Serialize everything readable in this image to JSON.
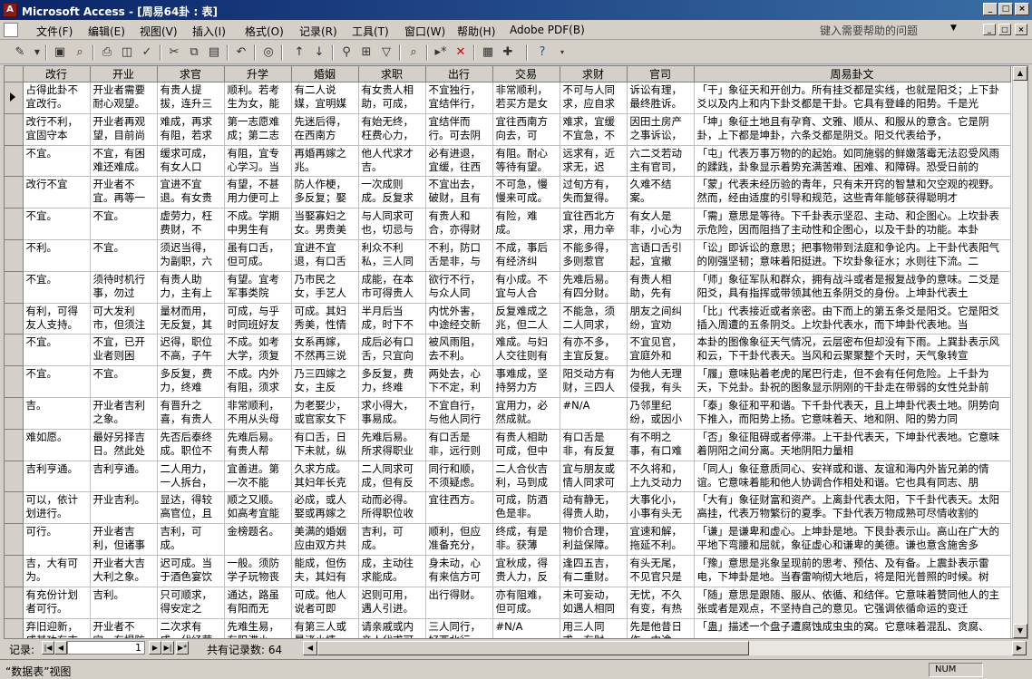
{
  "window": {
    "title": "Microsoft Access - [周易64卦 : 表]"
  },
  "menu": {
    "items": [
      "文件(F)",
      "编辑(E)",
      "视图(V)",
      "插入(I)",
      "格式(O)",
      "记录(R)",
      "工具(T)",
      "窗口(W)",
      "帮助(H)",
      "Adobe PDF(B)"
    ],
    "help_placeholder": "键入需要帮助的问题"
  },
  "table": {
    "columns": [
      "改行",
      "开业",
      "求官",
      "升学",
      "婚姻",
      "求职",
      "出行",
      "交易",
      "求财",
      "官司",
      "周易卦文"
    ],
    "rows": [
      [
        "占得此卦不宜改行。",
        "开业者需要耐心观望。",
        "有贵人提拔，连升三",
        "顺利。若考生为女，能",
        "有二人说媒，宜明媒",
        "有女贵人相助，可成，",
        "不宜独行，宜结伴行，",
        "非常顺利，若买方是女",
        "不可与人同求，应自求",
        "诉讼有理，最终胜诉。",
        "「干」象征天和开创力。所有挂爻都是实线，也就是阳爻；上下卦爻以及内上和内下卦爻都是干卦。它具有登峰的阳势。千是光"
      ],
      [
        "改行不利，宜固守本",
        "开业者再观望，目前尚",
        "难成，再求有阻，若求",
        "第一志愿难成；第二志",
        "先迷后得，在西南方",
        "有始无终，枉费心力，",
        "宜结伴而行。可去阴",
        "宜往西南方向去，可",
        "难求，宜缓不宜急，不",
        "因田土房产之事诉讼，",
        "「坤」象征土地且有孕育、文雅、顺从、和服从的意含。它是阴卦，上下都是坤卦，六条爻都是阴爻。阳爻代表给予，"
      ],
      [
        "不宜。",
        "不宜，有困难还难成。",
        "缓求可成，有女人口",
        "有阻，宜专心学习。当",
        "再婚再嫁之兆。",
        "他人代求才吉。",
        "必有进退，宜缓，往西",
        "有阻。耐心等待有望。",
        "远求有，近求无，迟",
        "六二爻若动主有官司，",
        "「屯」代表万事万物的的起始。如同施弱的鲜嫩落霉无法忍受风雨的蹂践，卦象显示着势充满苦难、困难、和障碍。恐受日前的"
      ],
      [
        "改行不宜",
        "开业者不宜。再等一",
        "宜进不宜退。有女贵",
        "有望，不甚用力便可上",
        "防人作梗，多反复；娶",
        "一次成则成。反复求",
        "不宜出去，破财，且有",
        "不可急，慢慢来可成。",
        "过旬方有，失而复得。",
        "久难不结案。",
        "「蒙」代表未经历验的青年，只有未开窍的智慧和欠空观的视野。然而，经由适度的引导和规范，这些青年能够获得聪明才"
      ],
      [
        "不宜。",
        "不宜。",
        "虚劳力，枉费财，不",
        "不成。学期中男生有",
        "当娶寡妇之女。男贵美",
        "与人同求可也，切忌与",
        "有贵人和合，亦得财",
        "有险，难成。",
        "宜往西北方求，用力辛",
        "有女人是非，小心为",
        "「需」意思是等待。下千卦表示坚忍、主动、和企图心。上坎卦表示危险，因而阻挡了主动性和企图心，以及干卦的功能。本卦"
      ],
      [
        "不利。",
        "不宜。",
        "须迟当得，为副职，六",
        "虽有口舌，但可成。",
        "宜进不宜退，有口舌",
        "利众不利私，三人同",
        "不利，防口舌是非，与",
        "不成，事后有经济纠",
        "不能多得，多则惹官",
        "言语口舌引起，宜撤",
        "「讼」即诉讼的意思；把事物带到法庭和争论内。上干卦代表阳气的刚强坚韧；意味着阳挺进。下坎卦象征水；水则往下流。二"
      ],
      [
        "不宜。",
        "须待时机行事，勿过",
        "有贵人助力，主有上",
        "有望。宜考军事类院",
        "乃市民之女，手艺人",
        "成能，在本市可得贵人",
        "欲行不行，与众人同",
        "有小成。不宜与人合",
        "先难后易。有四分财。",
        "有贵人相助，先有",
        "「师」象征军队和群众，拥有战斗或者是报复战争的意味。二爻是阳爻，具有指挥或带领其他五条阴爻的身份。上坤卦代表土"
      ],
      [
        "有利，可得友人支持。",
        "可大发利市，但须注",
        "量材而用，无反复，其",
        "可成，与乎时同班好友",
        "可成。其妇秀美，性情",
        "半月后当成，时下不",
        "内忧外害，中途经交新",
        "反复难成之兆，但二人",
        "不能急，须二人同求，不",
        "朋友之间纠纷，宜劝",
        "「比」代表接近或者亲密。由下而上的第五条爻是阳爻。它是阳爻插入周遭的五条阴爻。上坎卦代表水，而下坤卦代表地。当"
      ],
      [
        "不宜。",
        "不宜，已开业者则困",
        "迟得，职位不高，子午",
        "不成。如考大学，须复",
        "女系再嫁，不然再三说",
        "成后必有口舌，只宜向",
        "被风雨阻，去不利。",
        "难成。与妇人交往则有",
        "有亦不多，主宜反复。",
        "不宜见官，宜庭外和",
        "本卦的图像象征天气情况，云层密布但却没有下雨。上巽卦表示风和云，下干卦代表天。当风和云聚聚整个天时，天气象转宣"
      ],
      [
        "不宜。",
        "不宜。",
        "多反复，费力，终难",
        "不成。内外有阻，须求",
        "乃三四嫁之女，主反",
        "多反复，费力，终难",
        "两处去，心下不定，利",
        "事难成，坚持努力方",
        "阳爻动方有财，三四人",
        "为他人无理侵我，有头",
        "「履」意味贴着老虎的尾巴行走，但不会有任何危险。上千卦为天，下兑卦。卦祝的图象显示阴刚的干卦走在带弱的女性兑卦前面。"
      ],
      [
        "吉。",
        "开业者吉利之象。",
        "有晋升之喜，有贵人",
        "非常顺利，不用从头母",
        "为老娶少，或官家女下",
        "求小得大，事易成。",
        "不宜自行，与他人同行",
        "宜用力，必然成就。",
        "#N/A",
        "乃邻里纪纷，或因小",
        "「泰」象征和平和谐。下千卦代表天，且上坤卦代表土地。阴势向下推入，而阳势上扬。它意味着天、地和阴、阳的势力同"
      ],
      [
        "难如愿。",
        "最好另择吉日。然此处",
        "先否后泰终成。职位不",
        "先难后易。有贵人帮",
        "有口舌，日下未就，纵",
        "先难后易。所求得职业",
        "有口舌是非，远行则",
        "有贵人相助可成，但中",
        "有口舌是非，有反复",
        "有不明之事，有口难",
        "「否」象征阻碍或者停滞。上干卦代表天，下坤卦代表地。它意味着阴阳之间分离。天地阴阳力量相"
      ],
      [
        "吉利亨通。",
        "吉利亨通。",
        "二人用力，一人拆台，",
        "宜善进。第一次不能",
        "久求方成。其妇年长克",
        "二人同求可成，但有反",
        "同行和顺，不须疑虑。",
        "二人合伙吉利，马到成",
        "宜与朋友或情人同求可",
        "不久将和，上九爻动力",
        "「同人」象征意质同心、安祥或和谐、友谊和海内外皆兄弟的情谊。它意味着能和他人协调合作相处和谐。它也具有同志、朋"
      ],
      [
        "可以，依计划进行。",
        "开业吉利。",
        "显达，得较高官位，且",
        "顺之又顺。如高考宜能",
        "必成，或人娶或再嫁之",
        "动而必得。所得职位收",
        "宜往西方。",
        "可成，防酒色是非。",
        "动有静无，得贵人助，",
        "大事化小，小事有头无",
        "「大有」象征财富和资产。上离卦代表太阳，下千卦代表天。太阳高挂，代表万物繁衍的夏季。下卦代表万物成熟可尽情收割的"
      ],
      [
        "可行。",
        "开业者吉利，但诸事",
        "吉利，可成。",
        "金榜题名。",
        "美满的婚姻应由双方共",
        "吉利，可成。",
        "顺利，但应准备充分，",
        "终成，有是非。获薄",
        "物价合理，利益保障。",
        "宜速和解，拖延不利。",
        "「谦」是谦卑和虚心。上坤卦是地。下艮卦表示山。高山在广大的平地下弯腰和屈就，象征虚心和谦卑的美德。谦也意含施舍多"
      ],
      [
        "吉，大有可为。",
        "开业者大吉大利之象。",
        "迟可成。当于酒色宴饮",
        "一般。须防学子玩物丧",
        "能成，但伤夫，其妇有",
        "成，主动往求能成。",
        "身未动，心有来信方可",
        "宜秋成，得贵人力，反",
        "逢四五吉，有二重财。",
        "有头无尾，不见官只是",
        "「豫」意思是兆象呈现前的思考、预估、及有备。上震卦表示雷电，下坤卦是地。当春雷响彻大地后，将是阳光普照的时候。树"
      ],
      [
        "有充份计划者可行。",
        "吉利。",
        "只可顺求，得安定之",
        "通达，路虽有阳而无",
        "可成。他人说者可即",
        "迟则可用，遇人引进。",
        "出行得财。",
        "亦有阻难，但可成。",
        "未可妄动，如遇人相同",
        "无忧，不久有变，有热",
        "「随」意思是跟随、服从、依循、和结伴。它意味着赞同他人的主张或者是观点，不坚持自己的意见。它强调依循命运的变迁"
      ],
      [
        "弃旧迎新，成其功有吉",
        "开业者不宜，有提防",
        "二次求有成，代经营",
        "先难生易，有阻滞小",
        "有第三人或暴诸小情",
        "请亲戚或内亲人代求可",
        "三人同行，好西北行",
        "#N/A",
        "用三人同求，有财",
        "先是他昔日作，中途",
        "「蛊」描述一个盘子遭腐蚀成虫虫的窝。它意味着混乱、贪腐、"
      ]
    ]
  },
  "navigation": {
    "label": "记录:",
    "current": "1",
    "total_text": "共有记录数: 64"
  },
  "status": {
    "text": "“数据表”视图",
    "num": "NUM"
  }
}
